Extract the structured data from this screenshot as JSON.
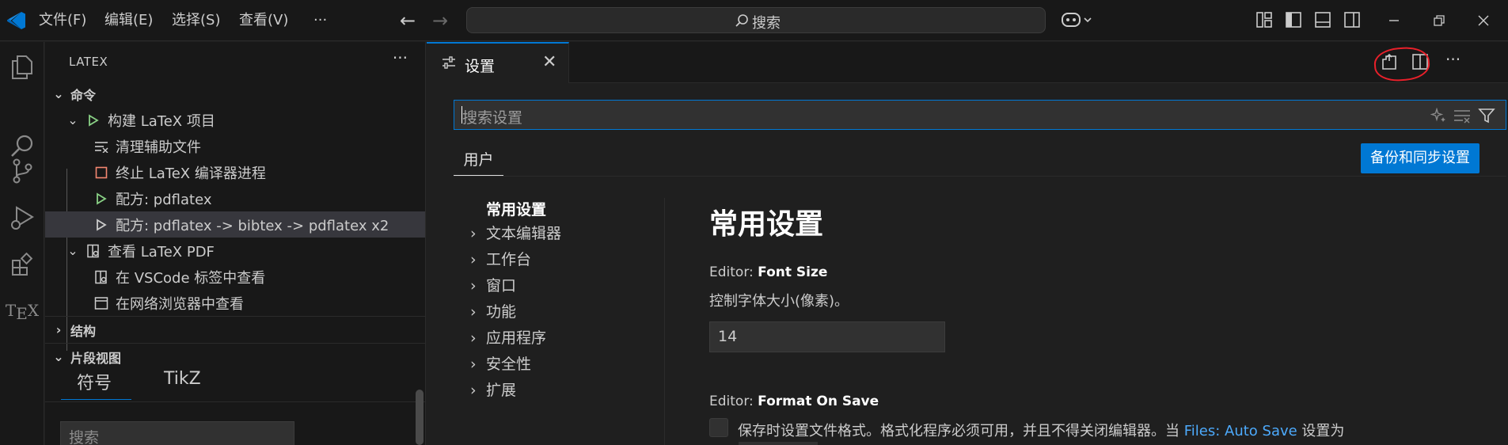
{
  "menubar": [
    "文件(F)",
    "编辑(E)",
    "选择(S)",
    "查看(V)",
    "···"
  ],
  "command_center": {
    "label": "搜索"
  },
  "sidebar": {
    "title": "LATEX",
    "sections": {
      "commands": "命令",
      "structure": "结构",
      "snippets": "片段视图"
    },
    "tree": [
      {
        "label": "构建 LaTeX 项目",
        "icon": "play-icon"
      },
      {
        "label": "清理辅助文件",
        "icon": "clear-all-icon"
      },
      {
        "label": "终止 LaTeX 编译器进程",
        "icon": "stop-icon"
      },
      {
        "label": "配方: pdflatex",
        "icon": "play-icon"
      },
      {
        "label": "配方: pdflatex -> bibtex -> pdflatex x2",
        "icon": "play-outline-icon"
      },
      {
        "label": "查看 LaTeX PDF",
        "icon": "open-preview-icon"
      },
      {
        "label": "在 VSCode 标签中查看",
        "icon": "open-preview-icon"
      },
      {
        "label": "在网络浏览器中查看",
        "icon": "browser-icon"
      }
    ],
    "snippet_tabs": [
      "符号",
      "TikZ"
    ],
    "snippet_search_placeholder": "搜索"
  },
  "editor": {
    "tab_label": "设置",
    "tab_close": "✕"
  },
  "settings": {
    "search_placeholder": "搜索设置",
    "scope_tab": "用户",
    "backup_button": "备份和同步设置",
    "toc": [
      "常用设置",
      "文本编辑器",
      "工作台",
      "窗口",
      "功能",
      "应用程序",
      "安全性",
      "扩展"
    ],
    "heading": "常用设置",
    "font_size": {
      "category": "Editor: ",
      "name": "Font Size",
      "description": "控制字体大小(像素)。",
      "value": "14"
    },
    "format_on_save": {
      "category": "Editor: ",
      "name": "Format On Save",
      "description_prefix": "保存时设置文件格式。格式化程序必须可用，并且不得关闭编辑器。当 ",
      "description_link": "Files: Auto Save",
      "description_suffix": " 设置为",
      "checked": false
    }
  },
  "colors": {
    "accent": "#0078d4",
    "annotation": "#e8202a"
  }
}
